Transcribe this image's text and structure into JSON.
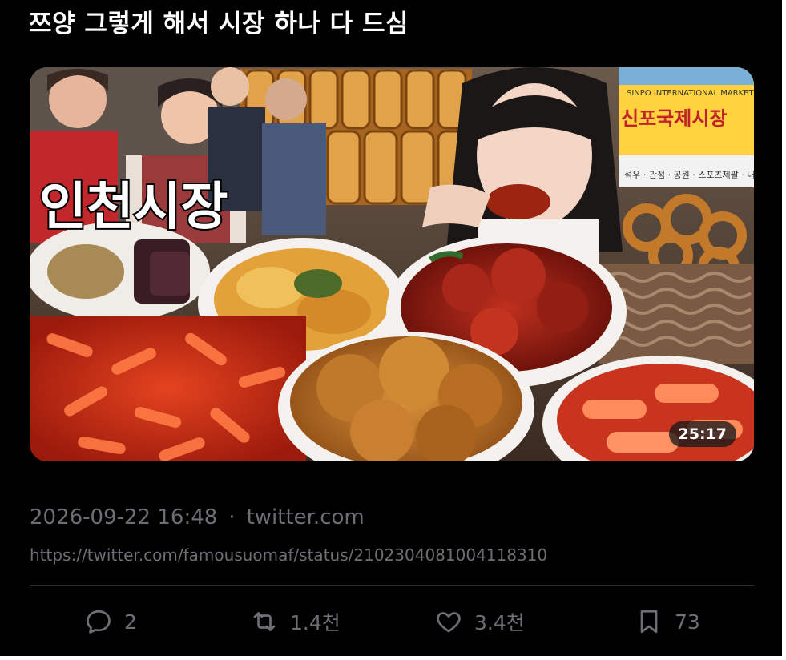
{
  "post": {
    "title": "쯔양 그렇게 해서 시장 하나 다 드심",
    "timestamp": "2026-09-22 16:48",
    "source": "twitter.com",
    "url": "https://twitter.com/famousuomaf/status/2102304081004118310"
  },
  "video": {
    "duration": "25:17",
    "overlay_text": "인천시장",
    "sign_text": "신포국제시장",
    "sign_subtext": "SINPO INTERNATIONAL MARKET",
    "banner_text": "석우 · 관점 · 공원 · 스포츠제팔 · 내리"
  },
  "actions": {
    "reply_count": "2",
    "retweet_count": "1.4천",
    "like_count": "3.4천",
    "bookmark_count": "73"
  },
  "colors": {
    "background": "#000000",
    "meta_text": "#6c6f73",
    "divider": "#2a2c2f"
  },
  "icons": {
    "reply": "reply-icon",
    "retweet": "retweet-icon",
    "like": "heart-icon",
    "bookmark": "bookmark-icon"
  }
}
